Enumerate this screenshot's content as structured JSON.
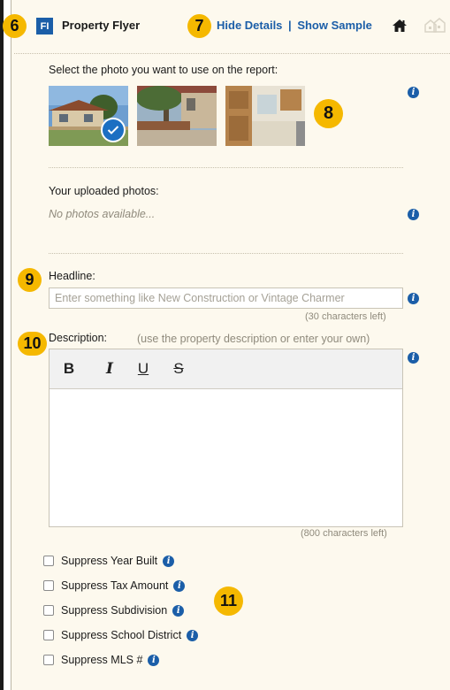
{
  "header": {
    "badge": "6",
    "logo_text": "FI",
    "title": "Property Flyer",
    "links_badge": "7",
    "hide_details": "Hide Details",
    "separator": "|",
    "show_sample": "Show Sample",
    "home_icon": "home-icon",
    "ghost_icon": "house-outline-icon"
  },
  "photos": {
    "prompt": "Select the photo you want to use on the report:",
    "badge": "8",
    "thumbnails": [
      {
        "name": "exterior-house",
        "selected": true
      },
      {
        "name": "patio-yard",
        "selected": false
      },
      {
        "name": "kitchen-interior",
        "selected": false
      }
    ]
  },
  "uploaded": {
    "label": "Your uploaded photos:",
    "empty_text": "No photos available..."
  },
  "headline": {
    "badge": "9",
    "label": "Headline:",
    "placeholder": "Enter something like New Construction or Vintage Charmer",
    "value": "",
    "chars_left": "(30 characters left)"
  },
  "description": {
    "badge": "10",
    "label": "Description:",
    "hint": "(use the property description or enter your own)",
    "toolbar": {
      "bold": "B",
      "italic": "I",
      "underline": "U",
      "strike": "S"
    },
    "chars_left": "(800 characters left)"
  },
  "options": {
    "badge": "11",
    "items": [
      {
        "label": "Suppress Year Built",
        "checked": false
      },
      {
        "label": "Suppress Tax Amount",
        "checked": false
      },
      {
        "label": "Suppress Subdivision",
        "checked": false
      },
      {
        "label": "Suppress School District",
        "checked": false
      },
      {
        "label": "Suppress MLS #",
        "checked": false
      }
    ]
  },
  "colors": {
    "panel_bg": "#fdf9ee",
    "accent_blue": "#1b5ea8",
    "badge_yellow": "#f5b800"
  }
}
